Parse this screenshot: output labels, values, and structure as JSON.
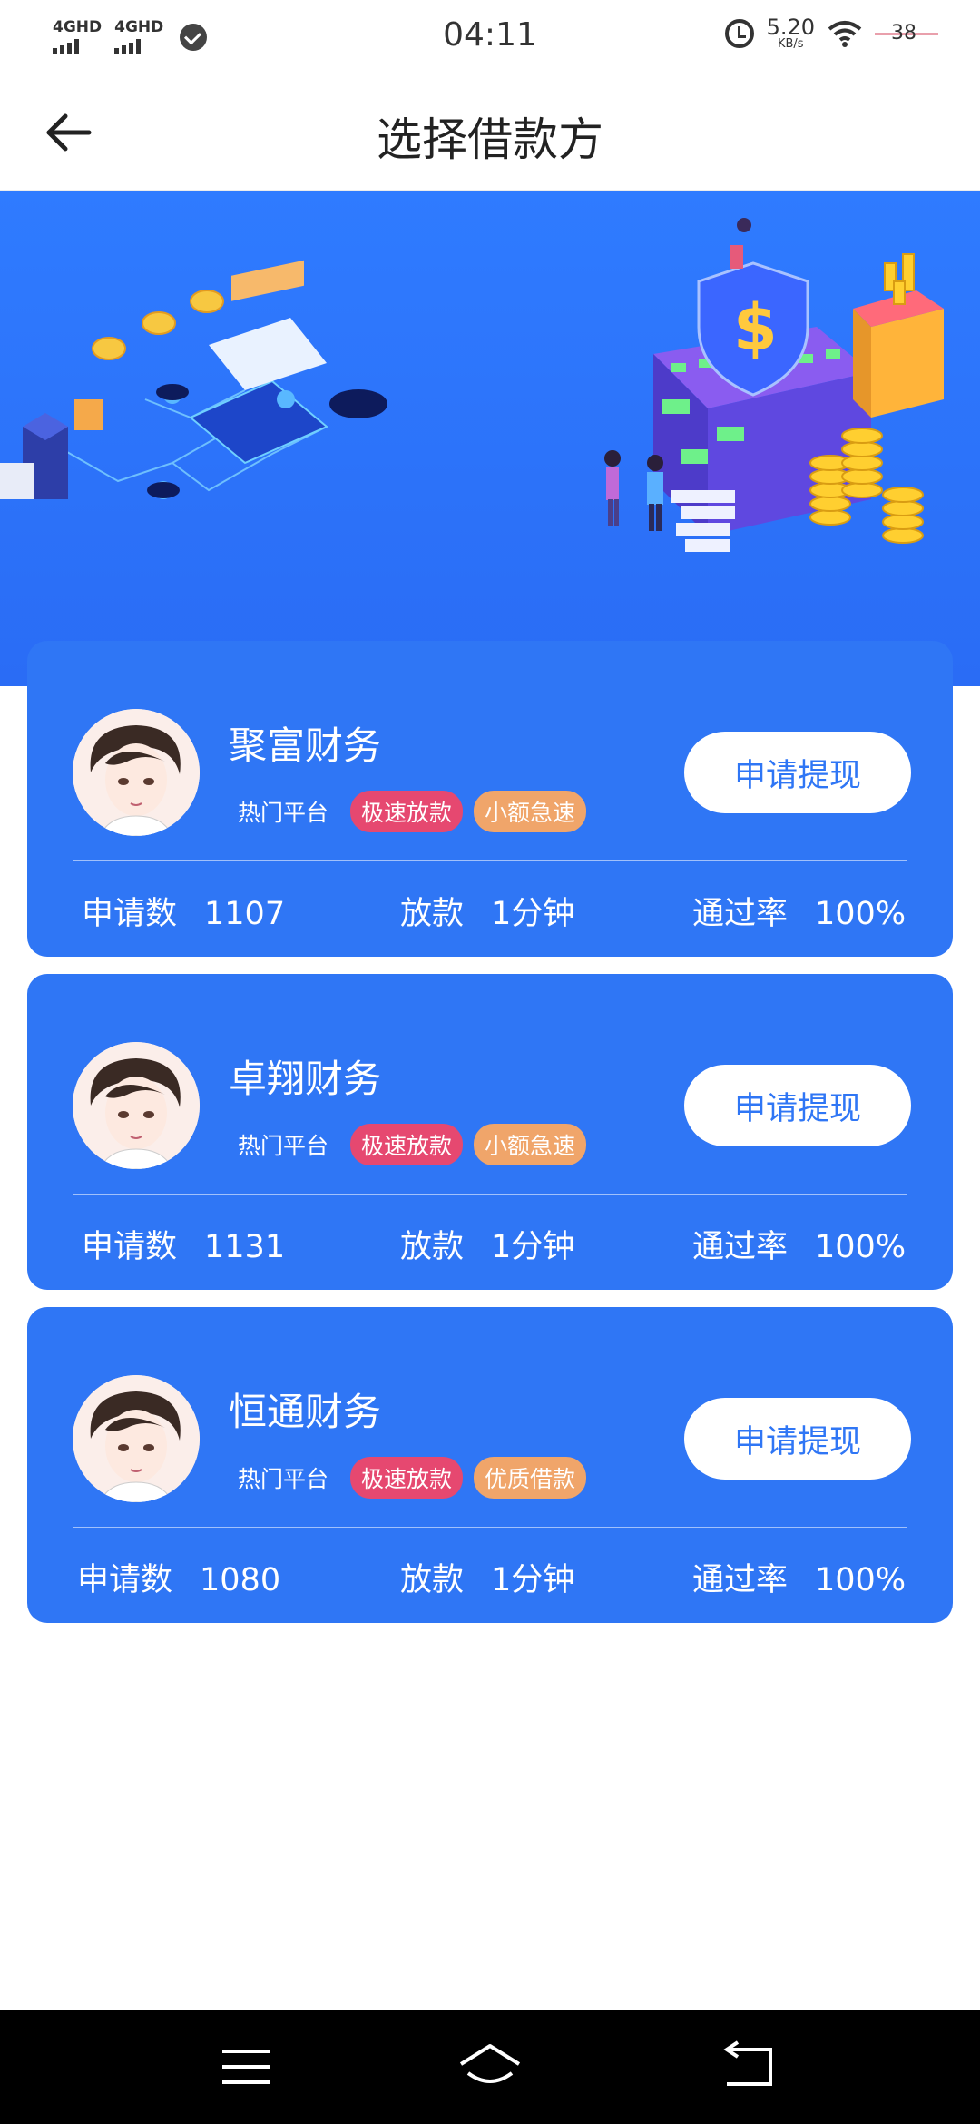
{
  "status_bar": {
    "network1": "4GHD",
    "network2": "4GHD",
    "time": "04:11",
    "speed_value": "5.20",
    "speed_unit": "KB/s",
    "battery": "38"
  },
  "header": {
    "title": "选择借款方",
    "back_icon": "arrow-left-icon"
  },
  "colors": {
    "primary": "#2f76f5",
    "banner": "#2f7bff",
    "tag_red": "#e64870",
    "tag_orange": "#f0a56a"
  },
  "cards": [
    {
      "name": "聚富财务",
      "tag_plain": "热门平台",
      "tag1": "极速放款",
      "tag2": "小额急速",
      "button": "申请提现",
      "applications_label": "申请数",
      "applications_value": "1107",
      "loan_label": "放款",
      "loan_value": "1分钟",
      "pass_label": "通过率",
      "pass_value": "100%"
    },
    {
      "name": "卓翔财务",
      "tag_plain": "热门平台",
      "tag1": "极速放款",
      "tag2": "小额急速",
      "button": "申请提现",
      "applications_label": "申请数",
      "applications_value": "1131",
      "loan_label": "放款",
      "loan_value": "1分钟",
      "pass_label": "通过率",
      "pass_value": "100%"
    },
    {
      "name": "恒通财务",
      "tag_plain": "热门平台",
      "tag1": "极速放款",
      "tag2": "优质借款",
      "button": "申请提现",
      "applications_label": "申请数",
      "applications_value": "1080",
      "loan_label": "放款",
      "loan_value": "1分钟",
      "pass_label": "通过率",
      "pass_value": "100%"
    }
  ],
  "nav_bar": {
    "menu_icon": "menu-icon",
    "home_icon": "home-icon",
    "back_icon": "back-icon"
  }
}
